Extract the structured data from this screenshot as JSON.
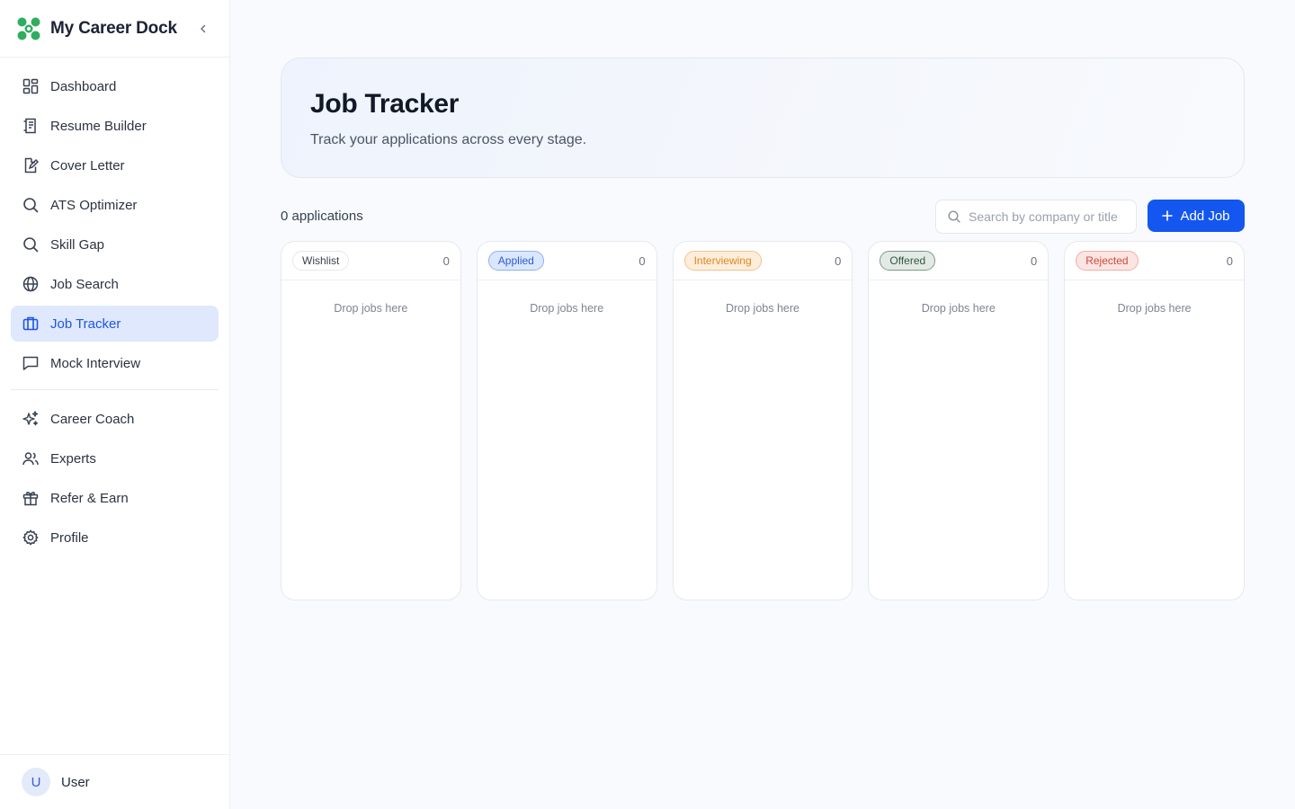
{
  "app": {
    "name": "My Career Dock"
  },
  "colors": {
    "brand_green": "#2fae62",
    "accent_blue": "#1357f0",
    "active_bg": "#dfe8fc"
  },
  "sidebar": {
    "collapse_icon": "chevron-left-icon",
    "items": [
      {
        "label": "Dashboard",
        "icon": "dashboard-icon",
        "active": false
      },
      {
        "label": "Resume Builder",
        "icon": "resume-icon",
        "active": false
      },
      {
        "label": "Cover Letter",
        "icon": "edit-file-icon",
        "active": false
      },
      {
        "label": "ATS Optimizer",
        "icon": "search-icon",
        "active": false
      },
      {
        "label": "Skill Gap",
        "icon": "search-icon",
        "active": false
      },
      {
        "label": "Job Search",
        "icon": "globe-icon",
        "active": false
      },
      {
        "label": "Job Tracker",
        "icon": "briefcase-icon",
        "active": true
      },
      {
        "label": "Mock Interview",
        "icon": "chat-icon",
        "active": false
      }
    ],
    "items_secondary": [
      {
        "label": "Career Coach",
        "icon": "sparkles-icon"
      },
      {
        "label": "Experts",
        "icon": "users-icon"
      },
      {
        "label": "Refer & Earn",
        "icon": "gift-icon"
      },
      {
        "label": "Profile",
        "icon": "gear-icon"
      }
    ],
    "user": {
      "initial": "U",
      "name": "User"
    }
  },
  "header": {
    "title": "Job Tracker",
    "subtitle": "Track your applications across every stage."
  },
  "toolbar": {
    "count_text": "0 applications",
    "search_placeholder": "Search by company or title",
    "search_value": "",
    "add_label": "Add Job"
  },
  "board": {
    "empty_text": "Drop jobs here",
    "columns": [
      {
        "label": "Wishlist",
        "count": "0",
        "bg": "#ffffff",
        "border": "#e5e7eb",
        "color": "#374151"
      },
      {
        "label": "Applied",
        "count": "0",
        "bg": "#dbe7fc",
        "border": "#8fb0f2",
        "color": "#2a5bd7"
      },
      {
        "label": "Interviewing",
        "count": "0",
        "bg": "#fdeedc",
        "border": "#f4c28c",
        "color": "#e0861e"
      },
      {
        "label": "Offered",
        "count": "0",
        "bg": "#e3eae5",
        "border": "#7a9a85",
        "color": "#2e5a3f"
      },
      {
        "label": "Rejected",
        "count": "0",
        "bg": "#fbe5e2",
        "border": "#efaea5",
        "color": "#d1483a"
      }
    ]
  }
}
